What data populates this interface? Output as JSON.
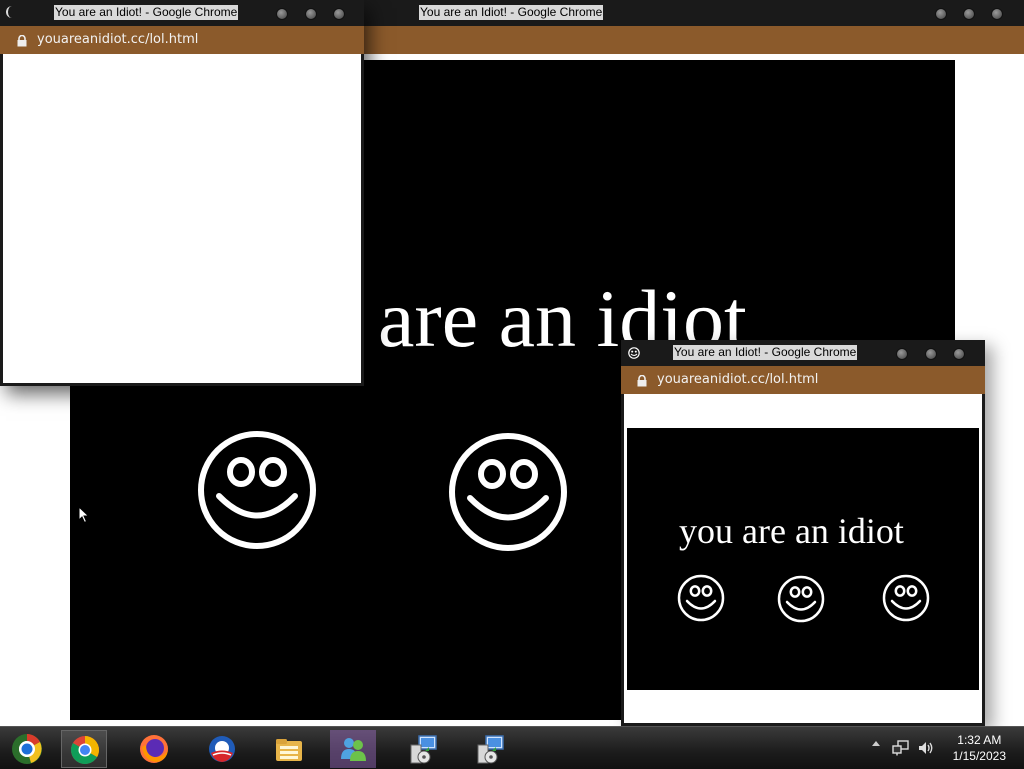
{
  "windows": {
    "main": {
      "title": "You are an Idiot! - Google Chrome"
    },
    "top_left": {
      "title": "You are an Idiot! - Google Chrome",
      "url": "youareanidiot.cc/lol.html"
    },
    "bottom_right": {
      "title": "You are an Idiot! - Google Chrome",
      "url": "youareanidiot.cc/lol.html"
    }
  },
  "page": {
    "big_text": "are an idiot",
    "small_text": "you are an idiot"
  },
  "taskbar": {
    "items": [
      "start-orb-icon",
      "chrome-icon",
      "firefox-icon",
      "obama-campaign-icon",
      "file-explorer-icon",
      "messenger-icon",
      "installer-icon",
      "installer-icon"
    ],
    "time": "1:32 AM",
    "date": "1/15/2023"
  },
  "colors": {
    "address_bar": "#8b5a2b",
    "titlebar": "#1a1a1a",
    "page_black": "#000000"
  }
}
